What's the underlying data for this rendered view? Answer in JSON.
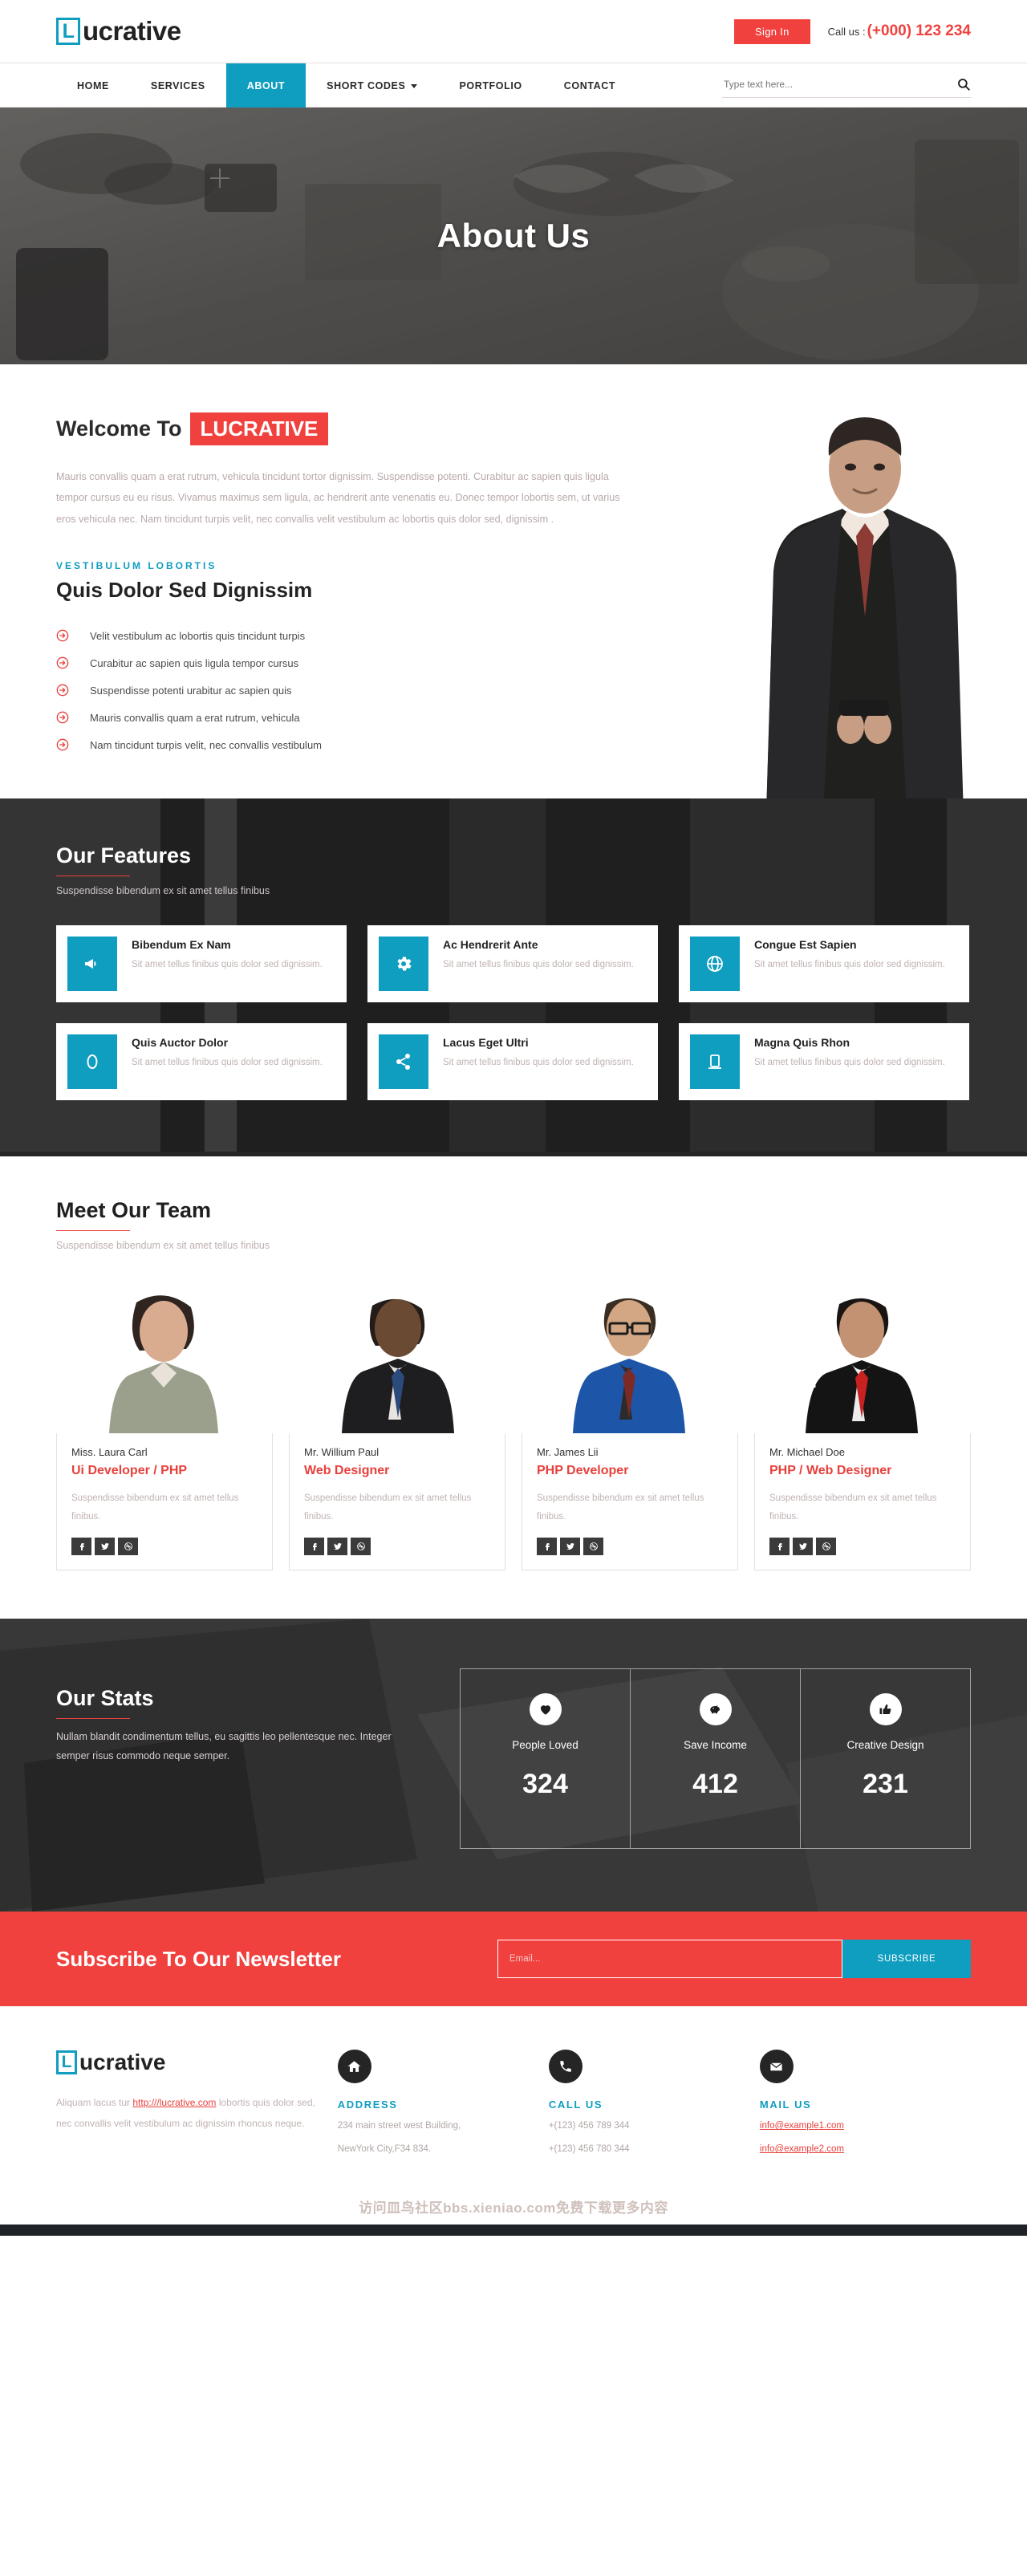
{
  "brand": {
    "box_letter": "L",
    "rest": "ucrative"
  },
  "topbar": {
    "sign_in": "Sign In",
    "call_label": "Call us :",
    "phone": "(+000) 123 234"
  },
  "nav": {
    "items": [
      {
        "label": "HOME",
        "active": false,
        "caret": false
      },
      {
        "label": "SERVICES",
        "active": false,
        "caret": false
      },
      {
        "label": "ABOUT",
        "active": true,
        "caret": false
      },
      {
        "label": "SHORT CODES",
        "active": false,
        "caret": true
      },
      {
        "label": "PORTFOLIO",
        "active": false,
        "caret": false
      },
      {
        "label": "CONTACT",
        "active": false,
        "caret": false
      }
    ],
    "search_placeholder": "Type text here..."
  },
  "hero": {
    "title": "About Us"
  },
  "welcome": {
    "heading": "Welcome To",
    "highlight": "LUCRATIVE",
    "lead": "Mauris convallis quam a erat rutrum, vehicula tincidunt tortor dignissim. Suspendisse potenti. Curabitur ac sapien quis ligula tempor cursus eu eu risus. Vivamus maximus sem ligula, ac hendrerit ante venenatis eu. Donec tempor lobortis sem, ut varius eros vehicula nec. Nam tincidunt turpis velit, nec convallis velit vestibulum ac lobortis quis dolor sed, dignissim .",
    "kicker": "VESTIBULUM LOBORTIS",
    "sub_title": "Quis Dolor Sed Dignissim",
    "list": [
      "Velit vestibulum ac lobortis quis tincidunt turpis",
      "Curabitur ac sapien quis ligula tempor cursus",
      "Suspendisse potenti urabitur ac sapien quis",
      "Mauris convallis quam a erat rutrum, vehicula",
      "Nam tincidunt turpis velit, nec convallis vestibulum"
    ]
  },
  "features": {
    "title": "Our Features",
    "subtitle": "Suspendisse bibendum ex sit amet tellus finibus",
    "cards": [
      {
        "icon": "megaphone-icon",
        "title": "Bibendum Ex Nam",
        "text": "Sit amet tellus finibus quis dolor sed dignissim."
      },
      {
        "icon": "gear-icon",
        "title": "Ac Hendrerit Ante",
        "text": "Sit amet tellus finibus quis dolor sed dignissim."
      },
      {
        "icon": "globe-icon",
        "title": "Congue Est Sapien",
        "text": "Sit amet tellus finibus quis dolor sed dignissim."
      },
      {
        "icon": "circle-icon",
        "title": "Quis Auctor Dolor",
        "text": "Sit amet tellus finibus quis dolor sed dignissim."
      },
      {
        "icon": "share-icon",
        "title": "Lacus Eget Ultri",
        "text": "Sit amet tellus finibus quis dolor sed dignissim."
      },
      {
        "icon": "laptop-icon",
        "title": "Magna Quis Rhon",
        "text": "Sit amet tellus finibus quis dolor sed dignissim."
      }
    ]
  },
  "team": {
    "title": "Meet Our Team",
    "subtitle": "Suspendisse bibendum ex sit amet tellus finibus",
    "members": [
      {
        "name": "Miss. Laura Carl",
        "role": "Ui Developer / PHP",
        "desc": "Suspendisse bibendum ex sit amet tellus finibus."
      },
      {
        "name": "Mr. Willium Paul",
        "role": "Web Designer",
        "desc": "Suspendisse bibendum ex sit amet tellus finibus."
      },
      {
        "name": "Mr. James Lii",
        "role": "PHP Developer",
        "desc": "Suspendisse bibendum ex sit amet tellus finibus."
      },
      {
        "name": "Mr. Michael Doe",
        "role": "PHP / Web Designer",
        "desc": "Suspendisse bibendum ex sit amet tellus finibus."
      }
    ],
    "social_icons": [
      "facebook-icon",
      "twitter-icon",
      "dribbble-icon"
    ]
  },
  "stats": {
    "title": "Our Stats",
    "desc": "Nullam blandit condimentum tellus, eu sagittis leo pellentesque nec. Integer semper risus commodo neque semper.",
    "boxes": [
      {
        "icon": "heart-icon",
        "label": "People Loved",
        "value": "324"
      },
      {
        "icon": "piggy-bank-icon",
        "label": "Save Income",
        "value": "412"
      },
      {
        "icon": "thumbs-up-icon",
        "label": "Creative Design",
        "value": "231"
      }
    ]
  },
  "newsletter": {
    "title": "Subscribe To Our Newsletter",
    "placeholder": "Email...",
    "button": "SUBSCRIBE"
  },
  "footer": {
    "about_pre": "Aliquam lacus tur ",
    "about_link": "http:///lucrative.com",
    "about_post": " lobortis quis dolor sed, nec convallis velit vestibulum ac dignissim rhoncus neque.",
    "columns": [
      {
        "icon": "home-icon",
        "head": "ADDRESS",
        "lines": [
          "234 main street west Building,",
          "NewYork City,F34 834."
        ],
        "link": false
      },
      {
        "icon": "phone-icon",
        "head": "CALL US",
        "lines": [
          "+(123) 456 789 344",
          "+(123) 456 780 344"
        ],
        "link": false
      },
      {
        "icon": "envelope-icon",
        "head": "MAIL US",
        "lines": [
          "info@example1.com",
          "info@example2.com"
        ],
        "link": true
      }
    ]
  },
  "watermark": "访问皿鸟社区bbs.xieniao.com免费下载更多内容",
  "colors": {
    "accent_teal": "#0f9dc0",
    "accent_red": "#f0413e",
    "dark": "#252525"
  }
}
